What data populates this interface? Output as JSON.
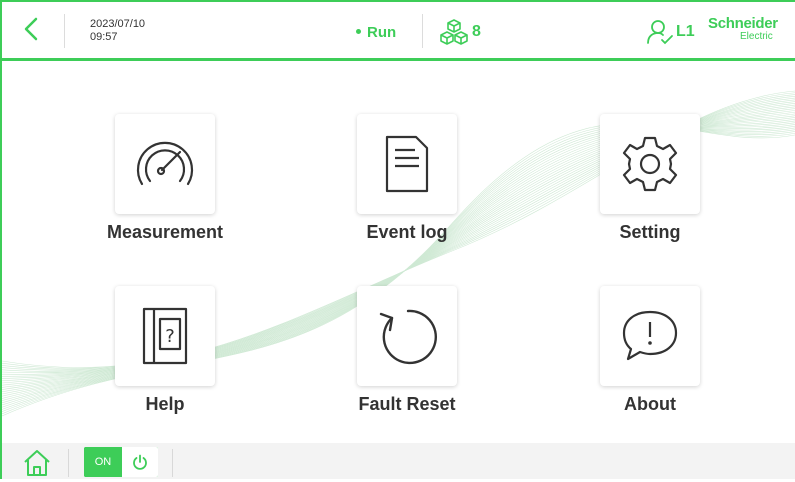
{
  "header": {
    "date": "2023/07/10",
    "time": "09:57",
    "status": "Run",
    "cube_count": "8",
    "user_level": "L1",
    "brand_line1": "Schneider",
    "brand_line2": "Electric"
  },
  "menu": [
    {
      "label": "Measurement",
      "icon": "gauge-icon"
    },
    {
      "label": "Event log",
      "icon": "document-icon"
    },
    {
      "label": "Setting",
      "icon": "gear-icon"
    },
    {
      "label": "Help",
      "icon": "help-book-icon"
    },
    {
      "label": "Fault Reset",
      "icon": "reset-icon"
    },
    {
      "label": "About",
      "icon": "speech-bubble-info-icon"
    }
  ],
  "footer": {
    "toggle_on_label": "ON"
  },
  "colors": {
    "accent": "#3dcd58",
    "text": "#333333"
  }
}
